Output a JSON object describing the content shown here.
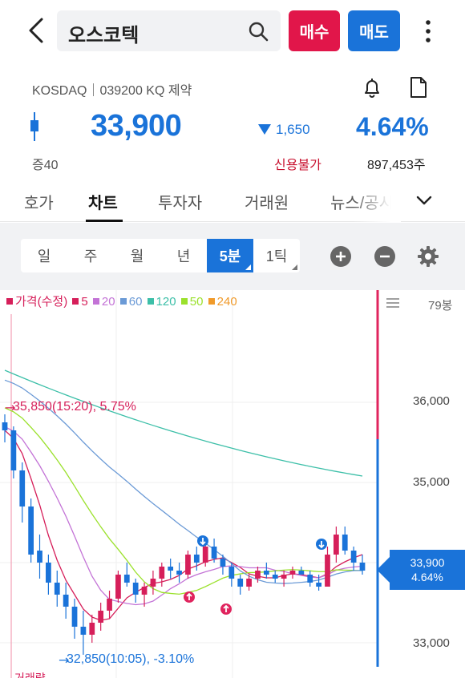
{
  "header": {
    "stock_name": "오스코텍",
    "buy_label": "매수",
    "sell_label": "매도"
  },
  "stock": {
    "info_line": "KOSDAQ｜039200 KQ 제약",
    "price": "33,900",
    "change": "1,650",
    "change_pct": "4.64%",
    "margin_rate": "증40",
    "credit_status": "신용불가",
    "volume": "897,453주"
  },
  "tabs": [
    "호가",
    "차트",
    "투자자",
    "거래원",
    "뉴스/공시"
  ],
  "active_tab": "차트",
  "periods": [
    "일",
    "주",
    "월",
    "년",
    "5분",
    "1틱"
  ],
  "active_period": "5분",
  "legend": [
    {
      "label": "가격(수정)",
      "color": "#d61f5a"
    },
    {
      "label": "5",
      "color": "#d61f5a"
    },
    {
      "label": "20",
      "color": "#c373d6"
    },
    {
      "label": "60",
      "color": "#6b9ad6"
    },
    {
      "label": "120",
      "color": "#3cbfa8"
    },
    {
      "label": "50",
      "color": "#9be12c"
    },
    {
      "label": "240",
      "color": "#f09a2a"
    }
  ],
  "bar_count": "79봉",
  "y_ticks": [
    "36,000",
    "35,000",
    "33,000"
  ],
  "high_marker": "35,850(15:20), 5.75%",
  "low_marker": "32,850(10:05), -3.10%",
  "current_price_box": {
    "price": "33,900",
    "pct": "4.64%"
  },
  "volume_label": "거래량",
  "colors": {
    "up": "#d61f5a",
    "down": "#1a73d9",
    "buy": "#e1164a",
    "sell": "#1a73d9"
  },
  "chart_data": {
    "type": "candlestick",
    "y_range": [
      32700,
      36900
    ],
    "y_ticks": [
      36000,
      35000,
      33000
    ],
    "candles": [
      [
        35750,
        35850,
        35500,
        35650
      ],
      [
        35650,
        35700,
        35050,
        35150
      ],
      [
        35150,
        35250,
        34500,
        34700
      ],
      [
        34700,
        34800,
        34000,
        34100
      ],
      [
        34150,
        34350,
        33800,
        34000
      ],
      [
        34000,
        34100,
        33600,
        33750
      ],
      [
        33750,
        33900,
        33450,
        33600
      ],
      [
        33600,
        33750,
        33300,
        33450
      ],
      [
        33450,
        33550,
        33050,
        33200
      ],
      [
        33200,
        33400,
        32850,
        33100
      ],
      [
        33100,
        33350,
        33000,
        33250
      ],
      [
        33250,
        33500,
        33150,
        33400
      ],
      [
        33400,
        33650,
        33300,
        33550
      ],
      [
        33550,
        33900,
        33500,
        33850
      ],
      [
        33850,
        34000,
        33700,
        33750
      ],
      [
        33750,
        33800,
        33500,
        33600
      ],
      [
        33600,
        33750,
        33450,
        33700
      ],
      [
        33700,
        33900,
        33600,
        33800
      ],
      [
        33800,
        34000,
        33700,
        33950
      ],
      [
        33950,
        34050,
        33800,
        33900
      ],
      [
        33900,
        34000,
        33750,
        33850
      ],
      [
        33850,
        34150,
        33800,
        34100
      ],
      [
        34100,
        34200,
        33900,
        34000
      ],
      [
        34000,
        34250,
        33950,
        34200
      ],
      [
        34200,
        34300,
        34000,
        34050
      ],
      [
        34050,
        34100,
        33850,
        33950
      ],
      [
        33950,
        34000,
        33700,
        33800
      ],
      [
        33800,
        33850,
        33600,
        33700
      ],
      [
        33700,
        33850,
        33650,
        33800
      ],
      [
        33800,
        33950,
        33750,
        33900
      ],
      [
        33900,
        34000,
        33800,
        33850
      ],
      [
        33850,
        33900,
        33750,
        33800
      ],
      [
        33800,
        33900,
        33700,
        33850
      ],
      [
        33850,
        33950,
        33800,
        33900
      ],
      [
        33900,
        33950,
        33850,
        33850
      ],
      [
        33850,
        33900,
        33700,
        33750
      ],
      [
        33750,
        33850,
        33650,
        33700
      ],
      [
        33700,
        34200,
        33700,
        34100
      ],
      [
        34100,
        34450,
        34000,
        34350
      ],
      [
        34350,
        34450,
        34100,
        34150
      ],
      [
        34150,
        34200,
        33900,
        34000
      ],
      [
        34000,
        34100,
        33850,
        33900
      ]
    ]
  }
}
